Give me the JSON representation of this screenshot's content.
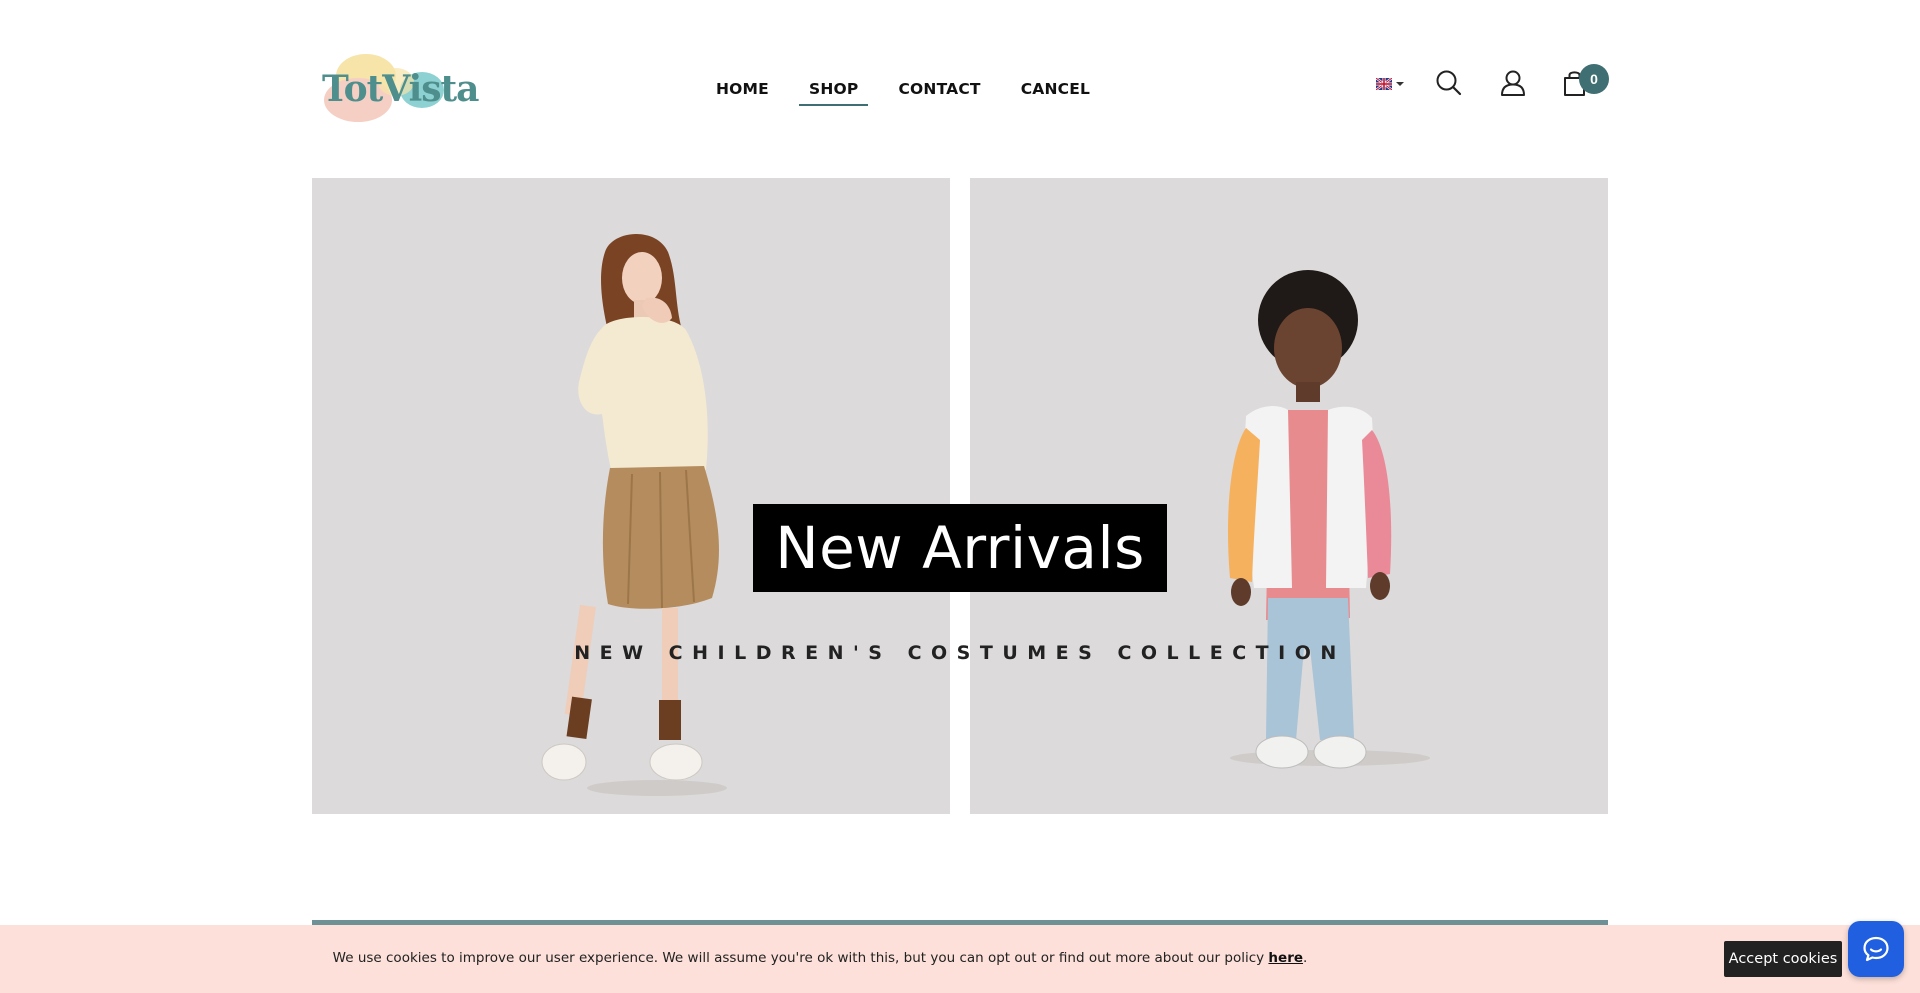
{
  "brand": {
    "logo_text": "TotVista",
    "colors": {
      "accent": "#3f6f72",
      "logo_text": "#4e8e8c",
      "logo_pink": "#f6cfc4",
      "logo_yellow": "#f7e4a8",
      "logo_teal": "#8ed1d2"
    }
  },
  "nav": {
    "items": [
      {
        "label": "HOME",
        "active": false
      },
      {
        "label": "SHOP",
        "active": true
      },
      {
        "label": "CONTACT",
        "active": false
      },
      {
        "label": "CANCEL",
        "active": false
      }
    ]
  },
  "header_tools": {
    "language_icon": "uk-flag-icon",
    "search_icon": "search-icon",
    "account_icon": "user-icon",
    "cart_icon": "shopping-bag-icon",
    "cart_count": "0"
  },
  "hero": {
    "title": "New Arrivals",
    "subtitle": "NEW CHILDREN'S COSTUMES COLLECTION",
    "panel_bg": "#dcdada"
  },
  "cookie_banner": {
    "text": "We use cookies to improve our user experience. We will assume you're ok with this, but you can opt out or find out more about our policy ",
    "link_text": "here",
    "suffix": ".",
    "accept_label": "Accept cookies",
    "bg_color": "#fde0d9"
  },
  "chat": {
    "icon": "chat-bubble-icon",
    "color": "#1f5fe0"
  }
}
